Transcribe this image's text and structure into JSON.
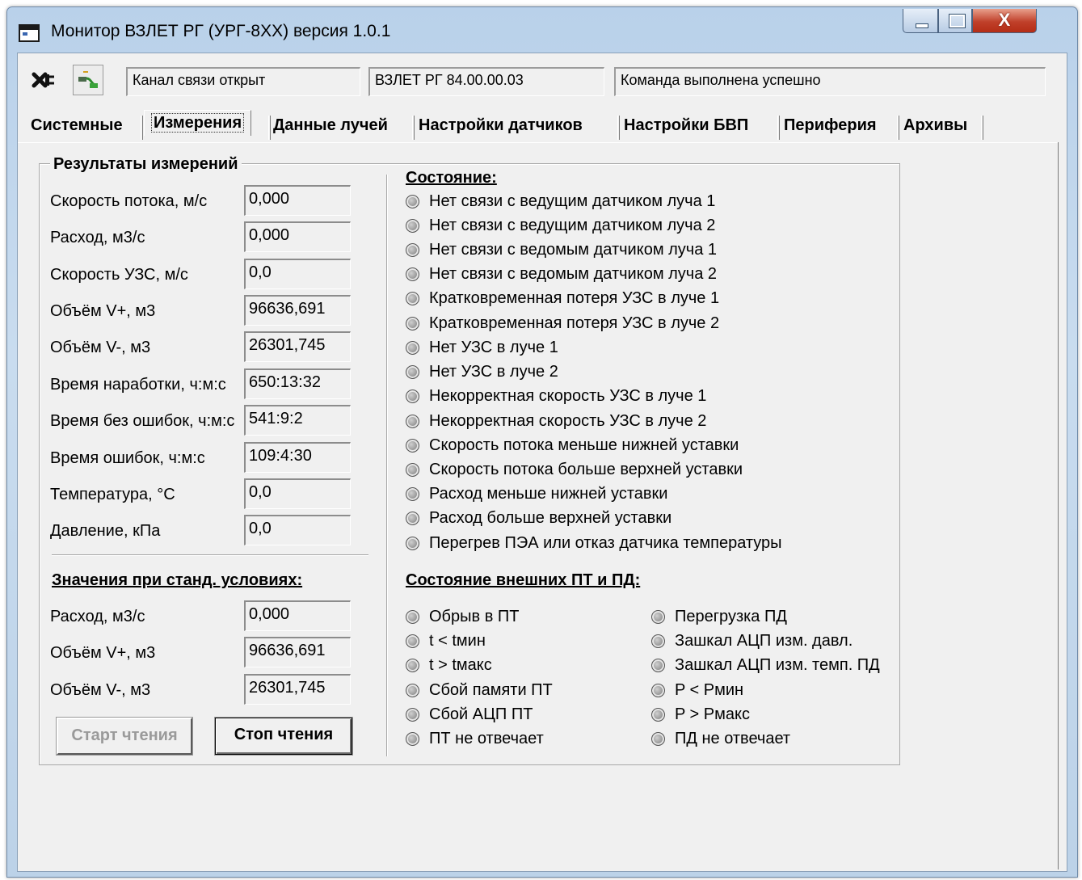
{
  "window": {
    "title": "Монитор ВЗЛЕТ РГ (УРГ-8XX) версия 1.0.1",
    "close_glyph": "X"
  },
  "toolbar": {
    "disconnect_icon": "disconnect-icon",
    "connect_icon": "connect-icon",
    "status_channel": "Канал связи открыт",
    "status_device": "ВЗЛЕТ РГ 84.00.00.03",
    "status_command": "Команда выполнена успешно"
  },
  "tabs": [
    {
      "label": "Системные"
    },
    {
      "label": "Измерения",
      "active": true
    },
    {
      "label": "Данные лучей"
    },
    {
      "label": "Настройки датчиков"
    },
    {
      "label": "Настройки БВП"
    },
    {
      "label": "Периферия"
    },
    {
      "label": "Архивы"
    }
  ],
  "results": {
    "title": "Результаты измерений",
    "fields": [
      {
        "label": "Скорость потока, м/с",
        "value": "0,000"
      },
      {
        "label": "Расход, м3/с",
        "value": "0,000"
      },
      {
        "label": "Скорость УЗС, м/с",
        "value": "0,0"
      },
      {
        "label": "Объём V+, м3",
        "value": "96636,691"
      },
      {
        "label": "Объём V-, м3",
        "value": "26301,745"
      },
      {
        "label": "Время наработки, ч:м:с",
        "value": "650:13:32"
      },
      {
        "label": "Время без ошибок, ч:м:с",
        "value": "541:9:2"
      },
      {
        "label": "Время ошибок, ч:м:с",
        "value": "109:4:30"
      },
      {
        "label": "Температура, °С",
        "value": "0,0"
      },
      {
        "label": "Давление, кПа",
        "value": "0,0"
      }
    ]
  },
  "standard": {
    "title": "Значения при станд. условиях:",
    "fields": [
      {
        "label": "Расход, м3/с",
        "value": "0,000"
      },
      {
        "label": "Объём V+, м3",
        "value": "96636,691"
      },
      {
        "label": "Объём V-, м3",
        "value": "26301,745"
      }
    ]
  },
  "buttons": {
    "start": "Старт чтения",
    "stop": "Стоп чтения"
  },
  "state": {
    "title": "Состояние:",
    "items": [
      "Нет связи с ведущим датчиком луча 1",
      "Нет связи с ведущим датчиком луча 2",
      "Нет связи с ведомым датчиком луча 1",
      "Нет связи с ведомым датчиком луча 2",
      "Кратковременная потеря УЗС в луче 1",
      "Кратковременная потеря УЗС в луче 2",
      "Нет УЗС в луче 1",
      "Нет УЗС в луче 2",
      "Некорректная скорость УЗС в луче 1",
      "Некорректная скорость УЗС в луче 2",
      "Скорость потока меньше нижней уставки",
      "Скорость потока больше верхней уставки",
      "Расход меньше нижней уставки",
      "Расход больше верхней уставки",
      "Перегрев ПЭА или отказ датчика температуры"
    ]
  },
  "external": {
    "title": "Состояние внешних ПТ и ПД:",
    "left": [
      "Обрыв в ПТ",
      "t < tмин",
      "t > tмакс",
      "Сбой памяти ПТ",
      "Сбой АЦП ПТ",
      "ПТ не отвечает"
    ],
    "right": [
      "Перегрузка ПД",
      "Зашкал АЦП изм. давл.",
      "Зашкал АЦП изм. темп. ПД",
      "P < Pмин",
      "P > Pмакс",
      "ПД не отвечает"
    ]
  }
}
